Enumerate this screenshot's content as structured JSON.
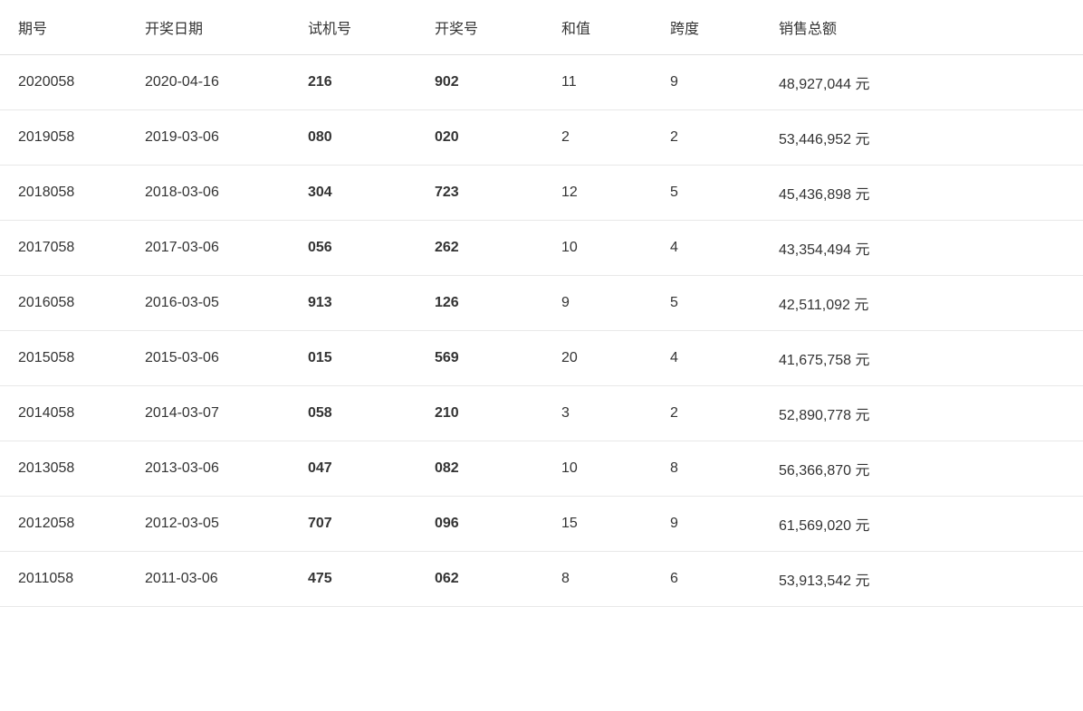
{
  "table": {
    "headers": [
      "期号",
      "开奖日期",
      "试机号",
      "开奖号",
      "和值",
      "跨度",
      "销售总额"
    ],
    "rows": [
      {
        "period": "2020058",
        "date": "2020-04-16",
        "trial": "216",
        "winning": "902",
        "sum": "11",
        "span": "9",
        "sales": "48,927,044 元"
      },
      {
        "period": "2019058",
        "date": "2019-03-06",
        "trial": "080",
        "winning": "020",
        "sum": "2",
        "span": "2",
        "sales": "53,446,952 元"
      },
      {
        "period": "2018058",
        "date": "2018-03-06",
        "trial": "304",
        "winning": "723",
        "sum": "12",
        "span": "5",
        "sales": "45,436,898 元"
      },
      {
        "period": "2017058",
        "date": "2017-03-06",
        "trial": "056",
        "winning": "262",
        "sum": "10",
        "span": "4",
        "sales": "43,354,494 元"
      },
      {
        "period": "2016058",
        "date": "2016-03-05",
        "trial": "913",
        "winning": "126",
        "sum": "9",
        "span": "5",
        "sales": "42,511,092 元"
      },
      {
        "period": "2015058",
        "date": "2015-03-06",
        "trial": "015",
        "winning": "569",
        "sum": "20",
        "span": "4",
        "sales": "41,675,758 元"
      },
      {
        "period": "2014058",
        "date": "2014-03-07",
        "trial": "058",
        "winning": "210",
        "sum": "3",
        "span": "2",
        "sales": "52,890,778 元"
      },
      {
        "period": "2013058",
        "date": "2013-03-06",
        "trial": "047",
        "winning": "082",
        "sum": "10",
        "span": "8",
        "sales": "56,366,870 元"
      },
      {
        "period": "2012058",
        "date": "2012-03-05",
        "trial": "707",
        "winning": "096",
        "sum": "15",
        "span": "9",
        "sales": "61,569,020 元"
      },
      {
        "period": "2011058",
        "date": "2011-03-06",
        "trial": "475",
        "winning": "062",
        "sum": "8",
        "span": "6",
        "sales": "53,913,542 元"
      }
    ]
  }
}
